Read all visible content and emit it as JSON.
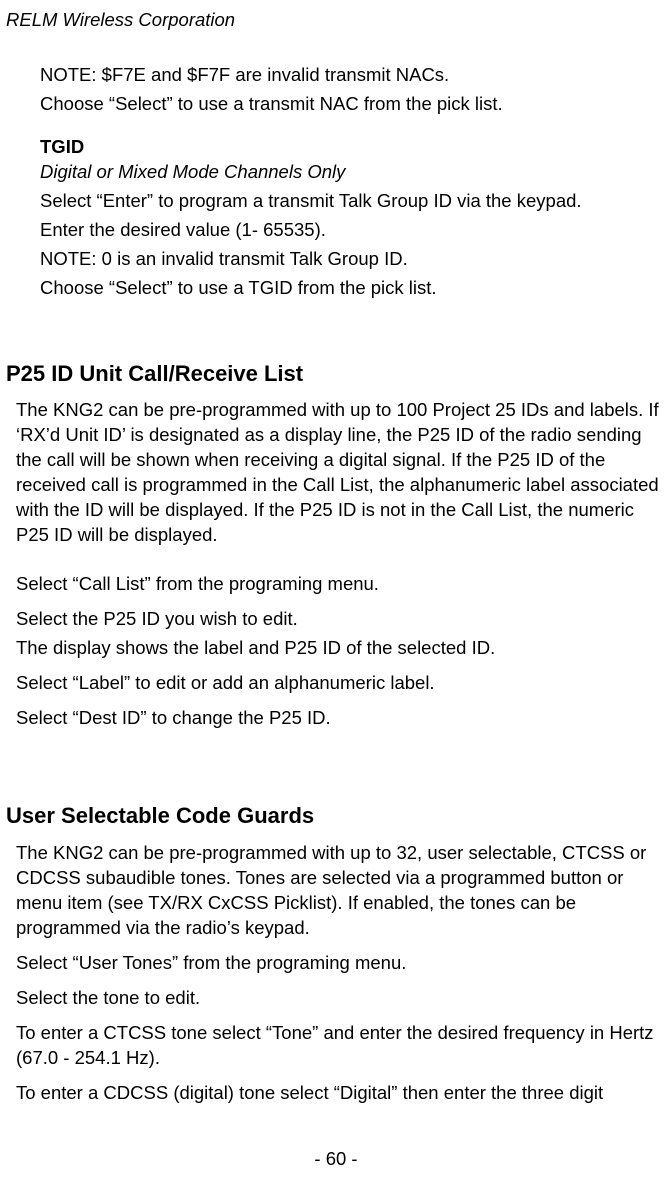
{
  "header": {
    "company": "RELM Wireless Corporation"
  },
  "topSection": {
    "note1": "NOTE: $F7E and $F7F are invalid transmit NACs.",
    "note2": "Choose “Select” to use a transmit NAC from the pick list.",
    "tgidTitle": "TGID",
    "tgidSubtitle": "Digital or Mixed Mode Channels Only",
    "tgidLine1": "Select “Enter” to program a transmit Talk Group ID via the keypad.",
    "tgidLine2": "Enter the desired value (1- 65535).",
    "tgidLine3": "NOTE: 0 is an invalid transmit Talk Group ID.",
    "tgidLine4": "Choose “Select” to use a TGID from the pick list."
  },
  "p25Section": {
    "title": "P25 ID Unit Call/Receive List",
    "body1": "The KNG2 can be pre-programmed with up to 100 Project 25 IDs and labels. If ‘RX’d Unit ID’ is designated as a display line, the P25 ID of the radio sending the call will be shown when receiving a digital signal. If the P25 ID of the received call is programmed in the Call List, the alphanumeric label associated with the ID will be displayed. If the P25 ID is not in the Call List, the numeric P25 ID will be displayed.",
    "body2": "Select “Call List” from the programing menu.",
    "body3a": "Select the P25 ID you wish to edit.",
    "body3b": "The display shows the label and P25 ID of the selected ID.",
    "body4": "Select “Label” to edit or add an alphanumeric label.",
    "body5": "Select “Dest ID” to change the P25 ID."
  },
  "userTonesSection": {
    "title": "User Selectable Code Guards",
    "body1": "The KNG2 can be pre-programmed with up to 32, user selectable, CTCSS or CDCSS subaudible tones. Tones are selected via a programmed button or menu item (see TX/RX CxCSS Picklist). If enabled, the tones can be programmed via the radio’s keypad.",
    "body2": "Select “User Tones” from the programing menu.",
    "body3": "Select the tone to edit.",
    "body4": "To enter a CTCSS tone select “Tone” and enter the desired frequency in Hertz (67.0 - 254.1 Hz).",
    "body5": "To enter a CDCSS (digital) tone select “Digital” then enter the three digit"
  },
  "pageNumber": "- 60 -"
}
